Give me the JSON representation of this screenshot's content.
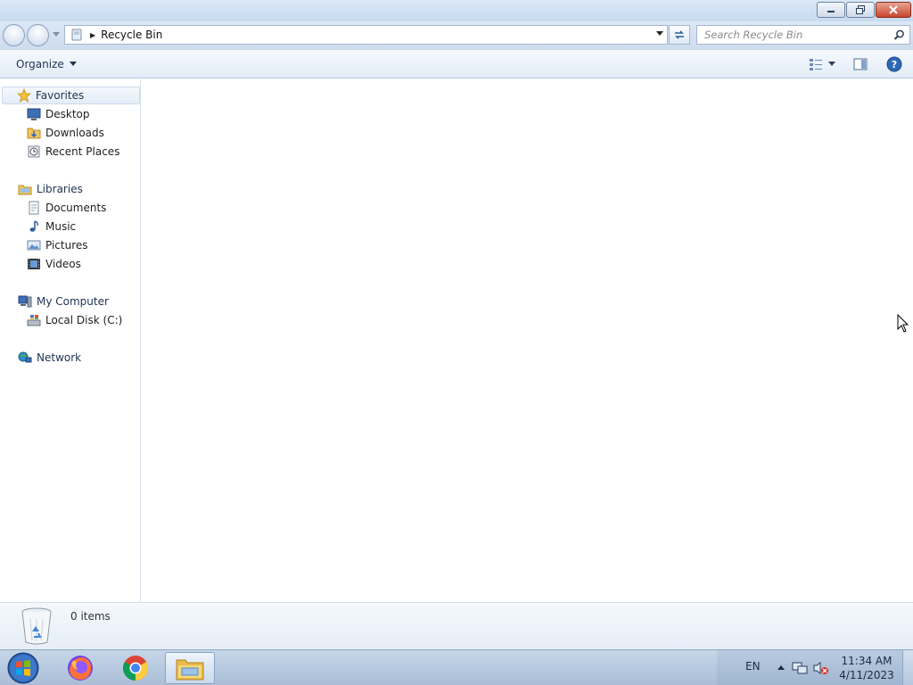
{
  "window": {
    "address": {
      "crumb": "Recycle Bin"
    },
    "search": {
      "placeholder": "Search Recycle Bin"
    },
    "toolbar": {
      "organize_label": "Organize"
    }
  },
  "navigation": {
    "favorites": {
      "label": "Favorites",
      "items": [
        {
          "label": "Desktop",
          "icon": "desktop-icon"
        },
        {
          "label": "Downloads",
          "icon": "downloads-icon"
        },
        {
          "label": "Recent Places",
          "icon": "recent-places-icon"
        }
      ]
    },
    "libraries": {
      "label": "Libraries",
      "items": [
        {
          "label": "Documents",
          "icon": "documents-icon"
        },
        {
          "label": "Music",
          "icon": "music-icon"
        },
        {
          "label": "Pictures",
          "icon": "pictures-icon"
        },
        {
          "label": "Videos",
          "icon": "videos-icon"
        }
      ]
    },
    "computer": {
      "label": "My Computer",
      "items": [
        {
          "label": "Local Disk (C:)",
          "icon": "local-disk-icon"
        }
      ]
    },
    "network": {
      "label": "Network"
    }
  },
  "details": {
    "item_count": "0 items"
  },
  "taskbar": {
    "apps": [
      "firefox",
      "chrome",
      "windows-explorer"
    ],
    "language": "EN",
    "time": "11:34 AM",
    "date": "4/11/2023"
  },
  "colors": {
    "titlebar": "#c8daf0",
    "taskbar": "#a9bed6",
    "close_button": "#c9452c",
    "link_text": "#1e3250"
  }
}
